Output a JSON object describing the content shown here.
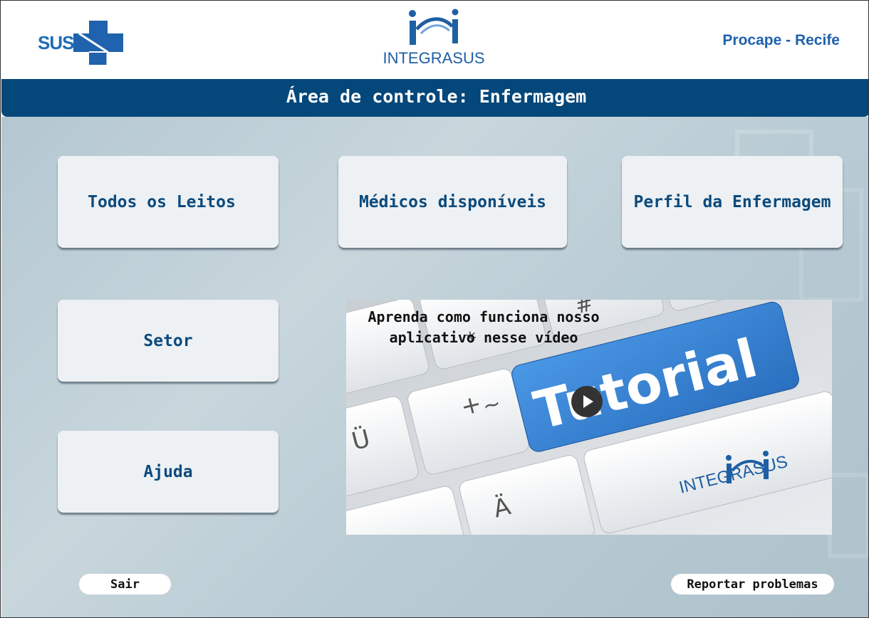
{
  "header": {
    "sus_logo_text": "SUS",
    "integra_logo_text": "INTEGRASUS",
    "location": "Procape - Recife"
  },
  "titlebar": {
    "title": "Área de controle: Enfermagem"
  },
  "menu": {
    "all_beds": "Todos os Leitos",
    "available_doctors": "Médicos disponíveis",
    "nursing_profile": "Perfil da Enfermagem",
    "sector": "Setor",
    "help": "Ajuda"
  },
  "video": {
    "caption_line1": "Aprenda como funciona nosso",
    "caption_line2": "aplicativo nesse vídeo",
    "thumbnail_word": "Tutorial",
    "thumbnail_brand": "INTEGRASUS",
    "key_glyphs": [
      "Ü",
      "Ä",
      "+",
      "#",
      "*",
      "~"
    ]
  },
  "footer": {
    "logout_label": "Sair",
    "report_label": "Reportar problemas"
  },
  "colors": {
    "primary_dark": "#04477a",
    "brand_blue": "#1f62ad",
    "card_bg": "#edf1f4",
    "tutorial_key": "#3a86d6"
  },
  "icons": [
    "sus-cross-icon",
    "integrasus-logo-icon",
    "play-icon"
  ]
}
